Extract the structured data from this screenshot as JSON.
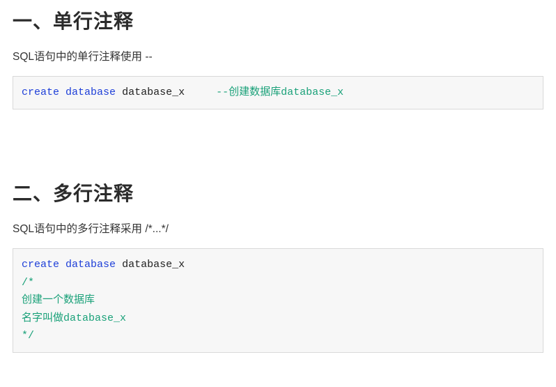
{
  "section1": {
    "heading": "一、单行注释",
    "desc": "SQL语句中的单行注释使用 --",
    "code": {
      "kw1": "create",
      "kw2": "database",
      "ident": "database_x",
      "gap": "     ",
      "comment": "--创建数据库database_x"
    }
  },
  "section2": {
    "heading": "二、多行注释",
    "desc": "SQL语句中的多行注释采用 /*...*/",
    "code": {
      "kw1": "create",
      "kw2": "database",
      "ident": "database_x",
      "c_open": "/*",
      "c_line1": "创建一个数据库",
      "c_line2": "名字叫做database_x",
      "c_close": "*/"
    }
  }
}
